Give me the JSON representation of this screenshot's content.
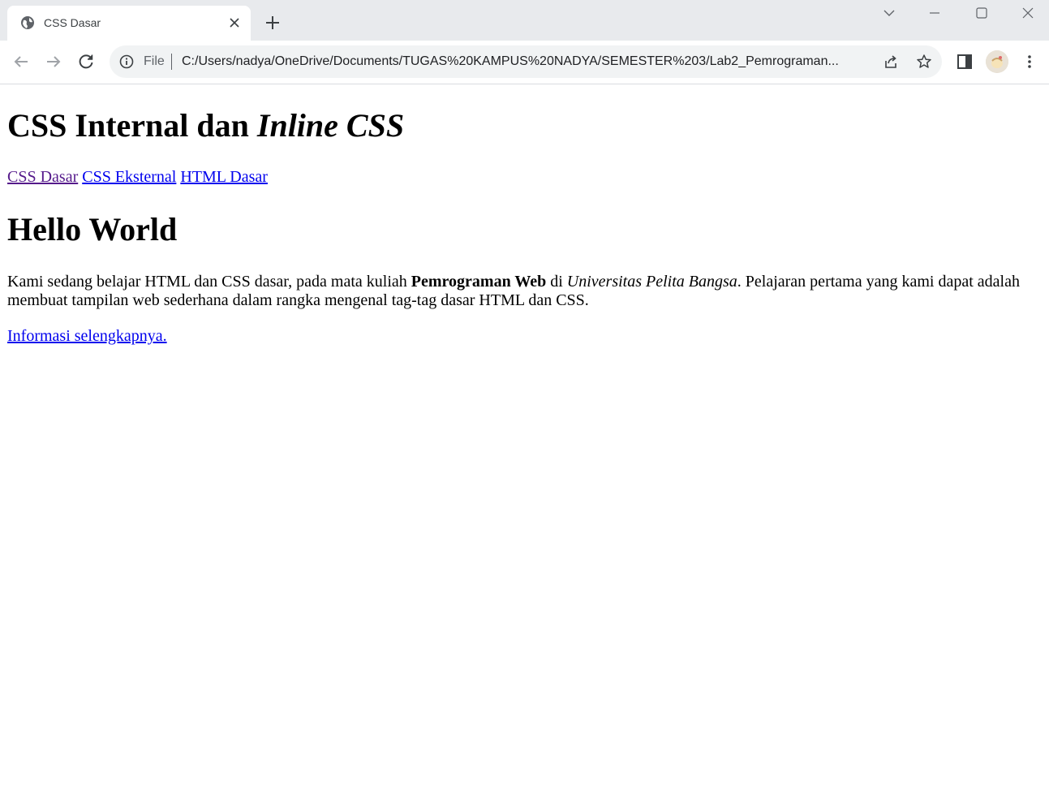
{
  "browser": {
    "tab": {
      "title": "CSS Dasar"
    },
    "address_bar": {
      "scheme_label": "File",
      "url": "C:/Users/nadya/OneDrive/Documents/TUGAS%20KAMPUS%20NADYA/SEMESTER%203/Lab2_Pemrograman..."
    }
  },
  "page": {
    "title_prefix": "CSS Internal dan ",
    "title_italic": "Inline CSS",
    "nav_links": [
      "CSS Dasar",
      "CSS Eksternal",
      "HTML Dasar"
    ],
    "heading": "Hello World",
    "paragraph": {
      "part1": "Kami sedang belajar HTML dan CSS dasar, pada mata kuliah ",
      "bold": "Pemrograman Web",
      "part2": " di ",
      "italic": "Universitas Pelita Bangsa",
      "part3": ". Pelajaran pertama yang kami dapat adalah membuat tampilan web sederhana dalam rangka mengenal tag-tag dasar HTML dan CSS."
    },
    "more_link": "Informasi selengkapnya."
  }
}
